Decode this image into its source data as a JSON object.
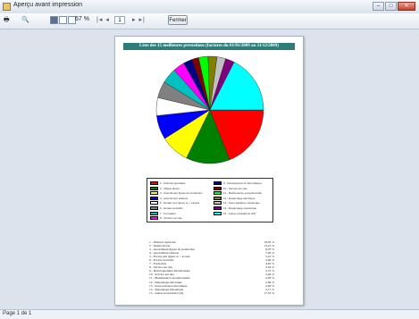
{
  "window": {
    "title": "Aperçu avant impression"
  },
  "toolbar": {
    "zoom_value": "67 %",
    "page_value": "1",
    "nav_prev": "|◂  ◂",
    "nav_next": "▸  ▸|",
    "close_label": "Fermer"
  },
  "report": {
    "title": "Liste des 15 meilleures prestations (factures du 01/01/2009 au 31/12/2009)"
  },
  "chart_data": {
    "type": "pie",
    "series": [
      {
        "values": [
          19.03,
          13.21,
          8.78,
          7.26,
          5.41,
          5.0,
          4.63,
          3.54,
          2.72,
          2.03,
          2.83,
          2.69,
          2.63,
          2.71,
          17.53
        ]
      }
    ],
    "colors": [
      "#ff0000",
      "#008000",
      "#ffff00",
      "#0000ff",
      "#ffffff",
      "#808080",
      "#00c0c0",
      "#ff00ff",
      "#000080",
      "#800000",
      "#00ff00",
      "#808000",
      "#c0c0c0",
      "#800080",
      "#00ffff"
    ]
  },
  "legend": {
    "items": [
      "1 - Montres spéciales",
      "2 - Objets divers",
      "3 - Assortiment lignes de production",
      "4 - Assortiment stations",
      "5 - Ecrans aux lignes sc. / écrans",
      "6 - Ecrans évolutifs",
      "7 - Formation",
      "8 - Service sur site",
      "9 - Développement informatique",
      "10 - Service sur site",
      "11 - Maintenance exceptionnelle",
      "12 - Dépannage électrique",
      "13 - Sous-traitance mécanique",
      "14 - Dépannage mécanique",
      "15 - Autres prestations (16)"
    ]
  },
  "list": [
    {
      "label": "1 - Montres spéciales",
      "pct": "19,03 %"
    },
    {
      "label": "2 - Objets divers",
      "pct": "13,21 %"
    },
    {
      "label": "3 - Assortiment lignes de production",
      "pct": "8,78 %"
    },
    {
      "label": "4 - Assortiment stations",
      "pct": "7,26 %"
    },
    {
      "label": "5 - Ecrans aux lignes sc. / écrans",
      "pct": "5,41 %"
    },
    {
      "label": "6 - Ecrans évolutifs",
      "pct": "5,00 %"
    },
    {
      "label": "7 - Formation",
      "pct": "4,63 %"
    },
    {
      "label": "8 - Service sur site",
      "pct": "3,54 %"
    },
    {
      "label": "9 - Développement informatique",
      "pct": "2,72 %"
    },
    {
      "label": "10 - Service sur site",
      "pct": "2,03 %"
    },
    {
      "label": "11 - Maintenance exceptionnelle",
      "pct": "2,83 %"
    },
    {
      "label": "12 - Dépannage électrique",
      "pct": "2,69 %"
    },
    {
      "label": "13 - Sous-traitance mécanique",
      "pct": "2,63 %"
    },
    {
      "label": "14 - Dépannage mécanique",
      "pct": "2,71 %"
    },
    {
      "label": "15 - Autres prestations (16)",
      "pct": "17,53 %"
    }
  ],
  "status": {
    "text": "Page 1 de 1"
  }
}
